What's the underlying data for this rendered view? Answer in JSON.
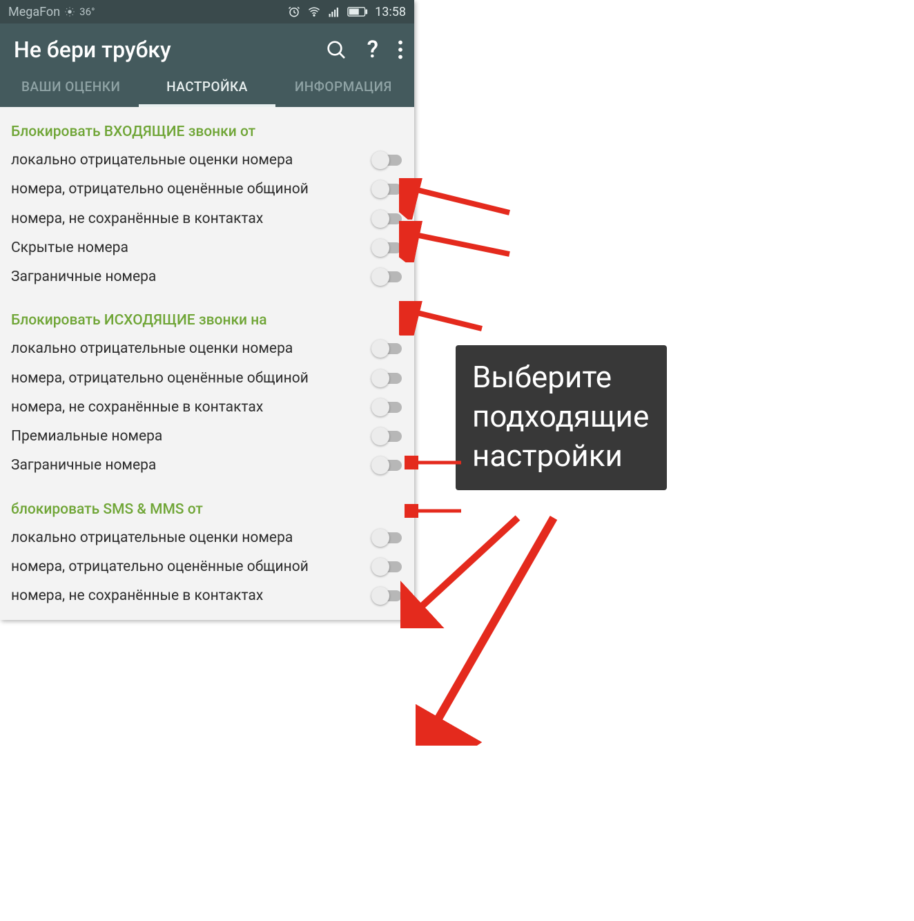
{
  "status_bar": {
    "carrier": "MegaFon",
    "temp": "36°",
    "time": "13:58"
  },
  "app": {
    "title": "Не бери трубку"
  },
  "tabs": {
    "t0": "ВАШИ ОЦЕНКИ",
    "t1": "НАСТРОЙКА",
    "t2": "ИНФОРМАЦИЯ"
  },
  "sections": {
    "incoming": {
      "title": "Блокировать ВХОДЯЩИЕ звонки от",
      "items": [
        "локально отрицательные оценки номера",
        "номера, отрицательно оценённые общиной",
        "номера, не сохранённые в контактах",
        "Скрытые номера",
        "Заграничные номера"
      ]
    },
    "outgoing": {
      "title": "Блокировать ИСХОДЯЩИЕ звонки на",
      "items": [
        "локально отрицательные оценки номера",
        "номера, отрицательно оценённые общиной",
        "номера, не сохранённые в контактах",
        "Премиальные номера",
        "Заграничные номера"
      ]
    },
    "sms": {
      "title": "блокировать SMS & MMS от",
      "items": [
        "локально отрицательные оценки номера",
        "номера, отрицательно оценённые общиной",
        "номера, не сохранённые в контактах"
      ]
    }
  },
  "callout": {
    "line1": "Выберите",
    "line2": "подходящие",
    "line3": "настройки"
  }
}
